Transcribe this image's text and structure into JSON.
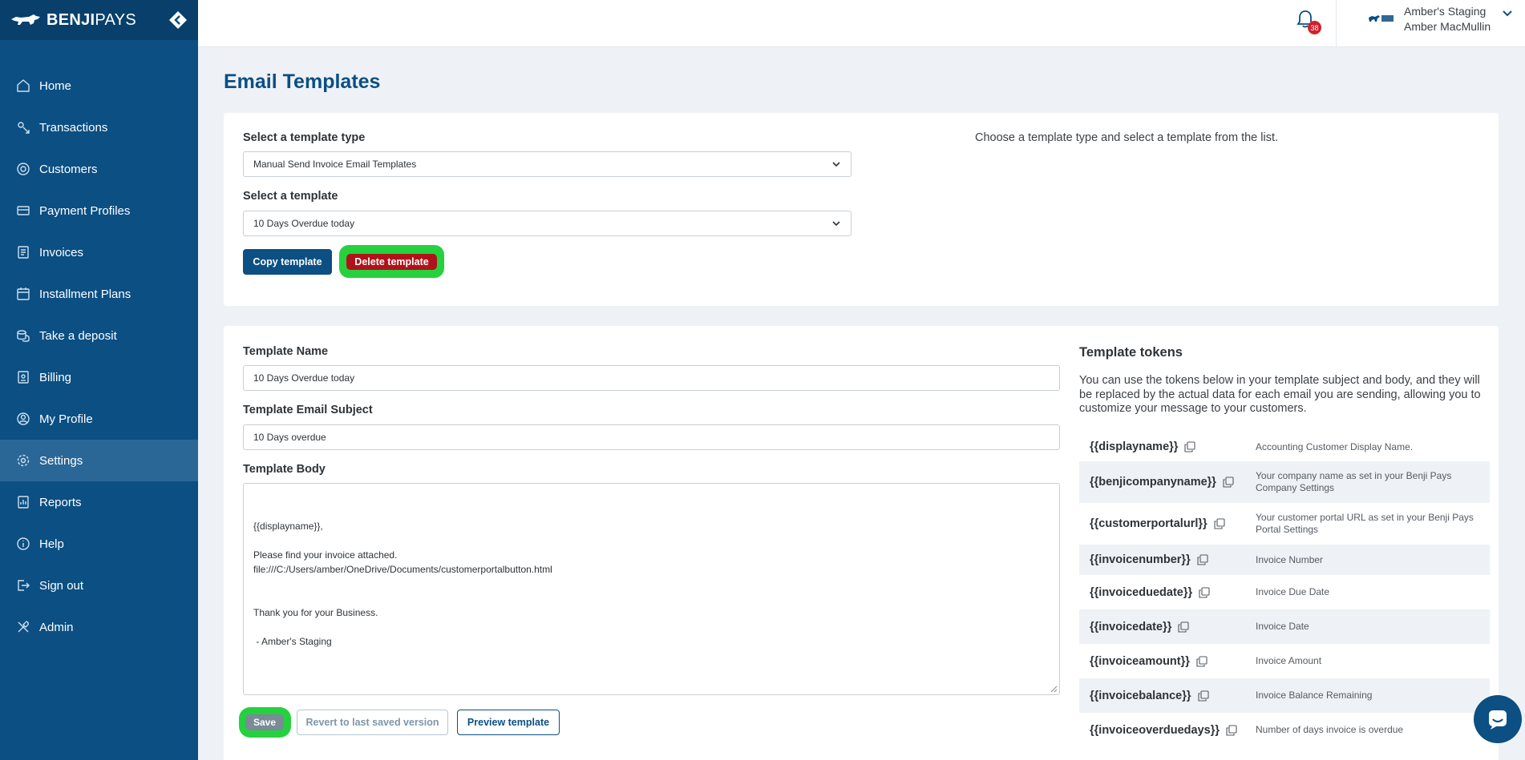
{
  "brand": {
    "name_bold": "BENJI",
    "name_light": "PAYS"
  },
  "sidebar": {
    "items": [
      {
        "label": "Home",
        "icon": "home-icon"
      },
      {
        "label": "Transactions",
        "icon": "transactions-icon"
      },
      {
        "label": "Customers",
        "icon": "customers-icon"
      },
      {
        "label": "Payment Profiles",
        "icon": "payment-profiles-icon"
      },
      {
        "label": "Invoices",
        "icon": "invoices-icon"
      },
      {
        "label": "Installment Plans",
        "icon": "calendar-icon"
      },
      {
        "label": "Take a deposit",
        "icon": "coins-icon"
      },
      {
        "label": "Billing",
        "icon": "billing-icon"
      },
      {
        "label": "My Profile",
        "icon": "user-circle-icon"
      },
      {
        "label": "Settings",
        "icon": "gear-icon"
      },
      {
        "label": "Reports",
        "icon": "reports-icon"
      },
      {
        "label": "Help",
        "icon": "info-icon"
      },
      {
        "label": "Sign out",
        "icon": "sign-out-icon"
      },
      {
        "label": "Admin",
        "icon": "tools-icon"
      }
    ],
    "active": "Settings"
  },
  "header": {
    "notification_count": "38",
    "account_name": "Amber's Staging",
    "user_name": "Amber MacMullin"
  },
  "page": {
    "title": "Email Templates"
  },
  "selector": {
    "type_label": "Select a template type",
    "type_value": "Manual Send Invoice Email Templates",
    "template_label": "Select a template",
    "template_value": "10 Days Overdue today",
    "copy_label": "Copy template",
    "delete_label": "Delete template",
    "hint": "Choose a template type and select a template from the list."
  },
  "editor": {
    "name_label": "Template Name",
    "name_value": "10 Days Overdue today",
    "subject_label": "Template Email Subject",
    "subject_value": "10 Days overdue",
    "body_label": "Template Body",
    "body_value": "{{displayname}},\n\nPlease find your invoice attached.\nfile:///C:/Users/amber/OneDrive/Documents/customerportalbutton.html\n\n\nThank you for your Business.\n\n - Amber's Staging",
    "save_label": "Save",
    "revert_label": "Revert to last saved version",
    "preview_label": "Preview template"
  },
  "tokens": {
    "title": "Template tokens",
    "description": "You can use the tokens below in your template subject and body, and they will be replaced by the actual data for each email you are sending, allowing you to customize your message to your customers.",
    "items": [
      {
        "token": "{{displayname}}",
        "desc": "Accounting Customer Display Name."
      },
      {
        "token": "{{benjicompanyname}}",
        "desc": "Your company name as set in your Benji Pays Company Settings"
      },
      {
        "token": "{{customerportalurl}}",
        "desc": "Your customer portal URL as set in your Benji Pays Portal Settings"
      },
      {
        "token": "{{invoicenumber}}",
        "desc": "Invoice Number"
      },
      {
        "token": "{{invoiceduedate}}",
        "desc": "Invoice Due Date"
      },
      {
        "token": "{{invoicedate}}",
        "desc": "Invoice Date"
      },
      {
        "token": "{{invoiceamount}}",
        "desc": "Invoice Amount"
      },
      {
        "token": "{{invoicebalance}}",
        "desc": "Invoice Balance Remaining"
      },
      {
        "token": "{{invoiceoverduedays}}",
        "desc": "Number of days invoice is overdue"
      }
    ]
  },
  "colors": {
    "sidebar": "#0b4f83",
    "sidebar_active": "#2a6797",
    "primary": "#0b4f83",
    "danger": "#b0121b",
    "highlight": "#25d13e"
  }
}
